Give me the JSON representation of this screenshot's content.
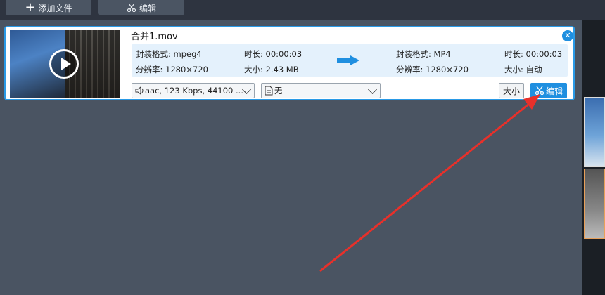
{
  "toolbar": {
    "add_file_label": "添加文件",
    "edit_label": "编辑"
  },
  "item": {
    "filename": "合并1.mov",
    "source": {
      "format_label": "封装格式:",
      "format_value": "mpeg4",
      "duration_label": "时长:",
      "duration_value": "00:00:03",
      "resolution_label": "分辨率:",
      "resolution_value": "1280×720",
      "size_label": "大小:",
      "size_value": "2.43 MB"
    },
    "target": {
      "format_label": "封装格式:",
      "format_value": "MP4",
      "duration_label": "时长:",
      "duration_value": "00:00:03",
      "resolution_label": "分辨率:",
      "resolution_value": "1280×720",
      "size_label": "大小:",
      "size_value": "自动"
    },
    "audio_select": "aac, 123 Kbps, 44100 ...",
    "subtitle_select": "无",
    "size_button": "大小",
    "edit_button": "编辑"
  },
  "colors": {
    "accent": "#1f8fe0",
    "card_border": "#2a9ae6",
    "info_bg": "#e4f1fc",
    "annotation_arrow": "#e8302a",
    "app_bg": "#4a5462"
  }
}
